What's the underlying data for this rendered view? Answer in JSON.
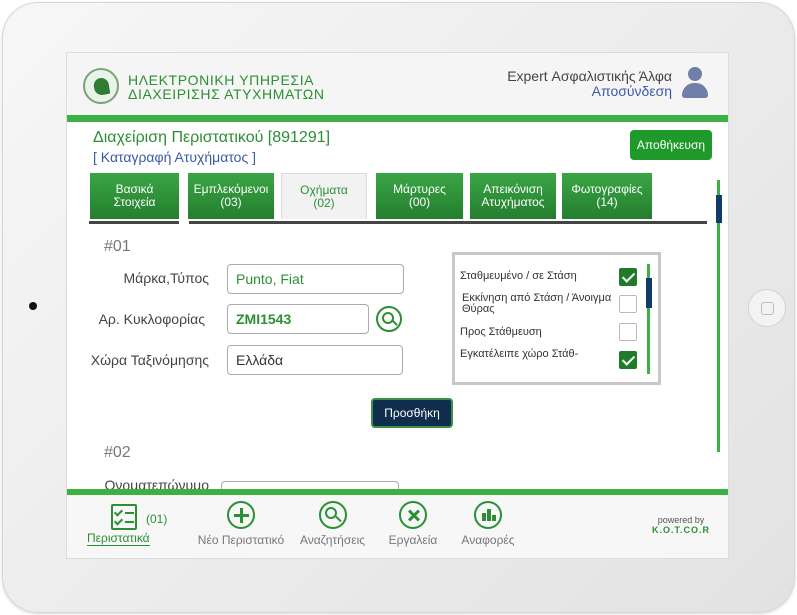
{
  "header": {
    "brand_line1": "ΗΛΕΚΤΡΟΝΙΚΗ ΥΠΗΡΕΣΙΑ",
    "brand_line2": "ΔΙΑΧΕΙΡΙΣΗΣ ΑΤΥΧΗΜΑΤΩΝ",
    "organization": "Expert Ασφαλιστικής Άλφα",
    "logout_label": "Αποσύνδεση",
    "logo_icon": "green-leaf-logo",
    "user_icon": "user-icon"
  },
  "page": {
    "title": "Διαχείριση Περιστατικού [891291]",
    "subtitle": "[ Καταγραφή Ατυχήματος ]",
    "save_label": "Αποθήκευση"
  },
  "tabs": [
    {
      "line1": "Βασικά",
      "line2": "Στοιχεία"
    },
    {
      "line1": "Εμπλεκόμενοι",
      "line2": "(03)"
    },
    {
      "line1": "Οχήματα",
      "line2": "(02)",
      "active": true
    },
    {
      "line1": "Μάρτυρες",
      "line2": "(00)"
    },
    {
      "line1": "Απεικόνιση",
      "line2": "Ατυχήματος"
    },
    {
      "line1": "Φωτογραφίες",
      "line2": "(14)"
    }
  ],
  "vehicle1": {
    "section_label": "#01",
    "make_label": "Μάρκα,Τύπος",
    "make_value": "Punto, Fiat",
    "plate_label": "Αρ. Κυκλοφορίας",
    "plate_value": "ZMI1543",
    "country_label": "Χώρα Ταξινόμησης",
    "country_value": "Ελλάδα",
    "add_label": "Προσθήκη"
  },
  "checkbox_options": [
    {
      "label": "Σταθμευμένο / σε Στάση",
      "checked": true
    },
    {
      "label": "Εκκίνηση από Στάση / Άνοιγμα Θύρας",
      "checked": false
    },
    {
      "label": "Προς Στάθμευση",
      "checked": false
    },
    {
      "label": "Εγκατέλειπε χώρο Στάθ-",
      "checked": true
    }
  ],
  "vehicle2": {
    "section_label": "#02",
    "partial_label": "Ονοματεπώνυμο"
  },
  "bottom_nav": {
    "cases_label": "Περιστατικά",
    "cases_count": "(01)",
    "new_case_label": "Νέο Περιστατικό",
    "search_label": "Αναζητήσεις",
    "tools_label": "Εργαλεία",
    "reports_label": "Αναφορές",
    "powered_by": "powered by",
    "powered_brand": "K.O.T.CO.R"
  },
  "colors": {
    "brand_green": "#2b8f34",
    "bar_green": "#3cb043",
    "dark_navy": "#0f2e4d",
    "link_blue": "#3a5aa8"
  }
}
